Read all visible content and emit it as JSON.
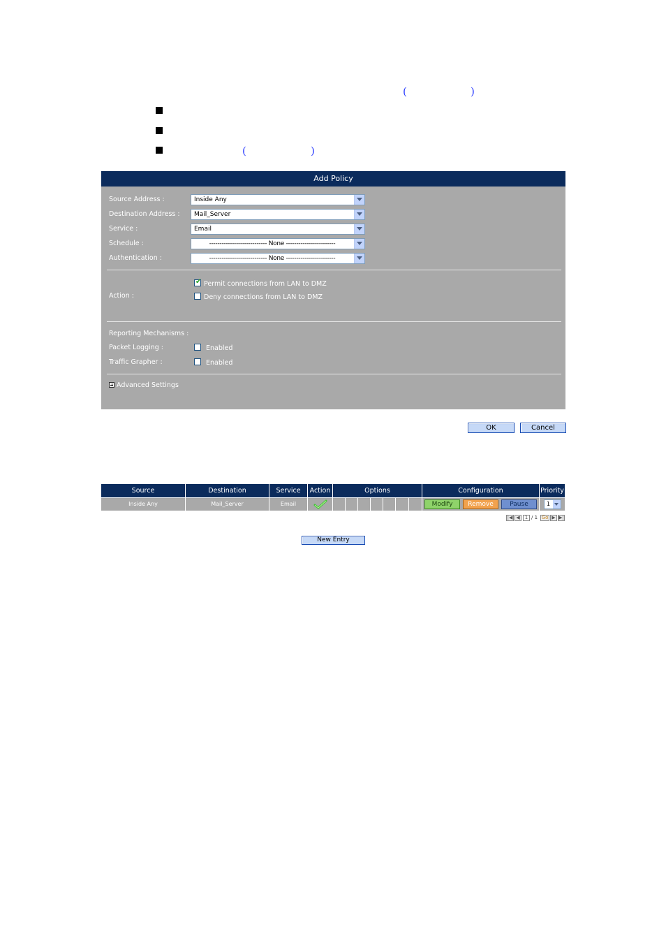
{
  "panel": {
    "title": "Add Policy",
    "fields": [
      {
        "label": "Source Address :",
        "value": "Inside Any"
      },
      {
        "label": "Destination Address :",
        "value": "Mail_Server"
      },
      {
        "label": "Service :",
        "value": "Email"
      },
      {
        "label": "Schedule :",
        "value": "---------------------------- None ------------------------"
      },
      {
        "label": "Authentication :",
        "value": "---------------------------- None ------------------------"
      }
    ],
    "action_label": "Action :",
    "permit_label": "Permit connections from LAN to DMZ",
    "permit_checked": true,
    "deny_label": "Deny connections from LAN to DMZ",
    "deny_checked": false,
    "reporting_label": "Reporting Mechanisms :",
    "packet_logging_label": "Packet Logging :",
    "traffic_grapher_label": "Traffic Grapher :",
    "enabled_label": "Enabled",
    "advanced_label": "Advanced Settings"
  },
  "buttons": {
    "ok": "OK",
    "cancel": "Cancel",
    "new_entry": "New Entry"
  },
  "table": {
    "headers": [
      "Source",
      "Destination",
      "Service",
      "Action",
      "Options",
      "Configuration",
      "Priority"
    ],
    "row": {
      "source": "Inside Any",
      "destination": "Mail_Server",
      "service": "Email",
      "modify": "Modify",
      "remove": "Remove",
      "pause": "Pause",
      "priority": "1"
    }
  },
  "pager": {
    "page": "1",
    "total": "/ 1",
    "go": "Go"
  },
  "colors": {
    "header": "#0b2b5c",
    "panel": "#a9a9a9",
    "modify": "#8fd36a",
    "remove": "#f2a24e",
    "pause": "#6f8fcf",
    "link_paren": "#2a3cff"
  }
}
